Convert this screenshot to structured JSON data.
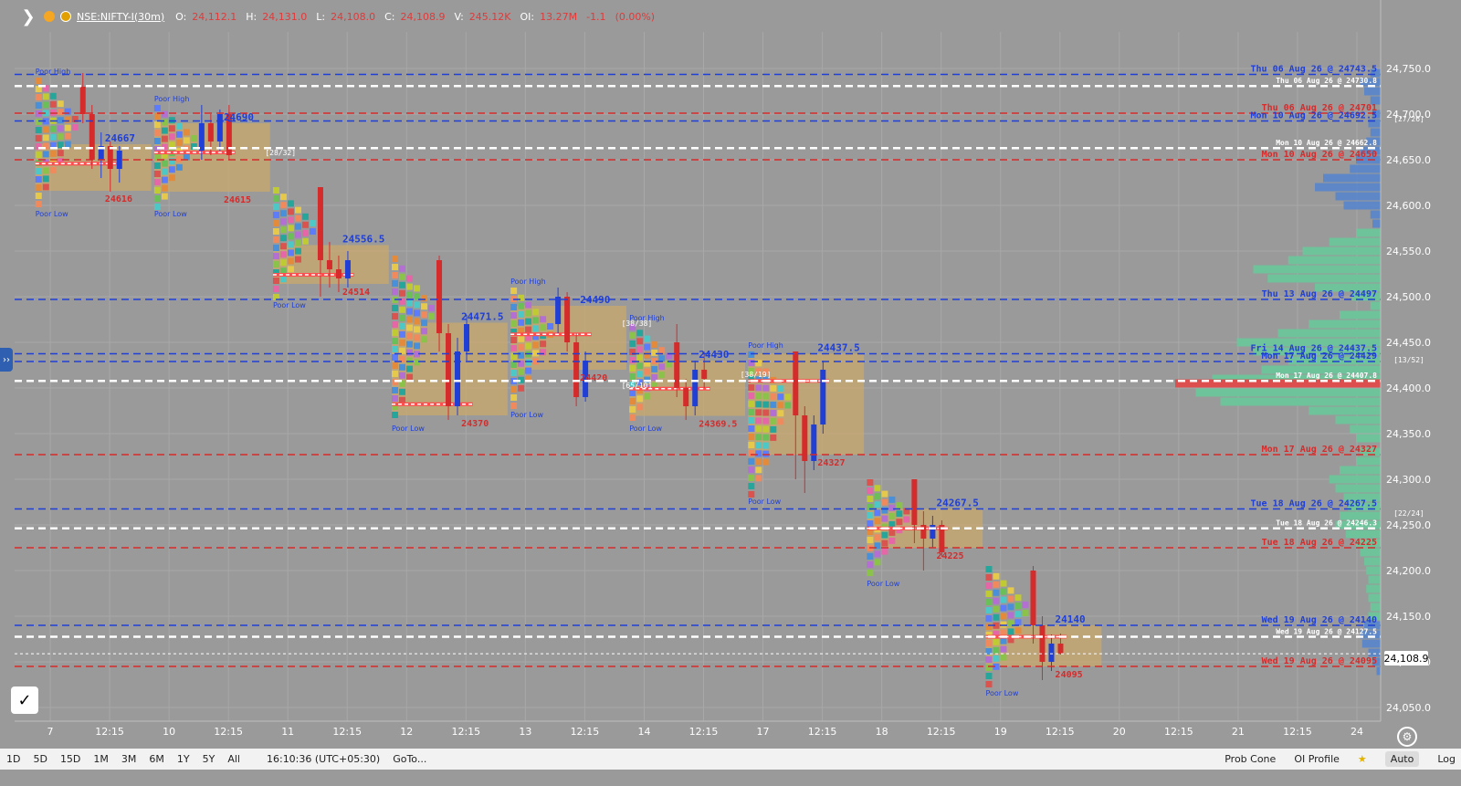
{
  "legend": {
    "symbol": "NSE:NIFTY-I(30m)",
    "o_label": "O:",
    "o_value": "24,112.1",
    "h_label": "H:",
    "h_value": "24,131.0",
    "l_label": "L:",
    "l_value": "24,108.0",
    "c_label": "C:",
    "c_value": "24,108.9",
    "v_label": "V:",
    "v_value": "245.12K",
    "oi_label": "OI:",
    "oi_value": "13.27M",
    "change": "-1.1",
    "change_pct": "(0.00%)"
  },
  "colors": {
    "up": "#1f3fd6",
    "down": "#d62b2b",
    "blue_line": "#1f3fd6",
    "red_line": "#d62b2b",
    "white_line": "#ffffff",
    "vp_green": "#6cc59a",
    "vp_blue": "#5a86c9",
    "vp_red": "#e04a4a",
    "value_area": "#c9a86c"
  },
  "current_price": "24,108.9",
  "bottom": {
    "timeframes": [
      "1D",
      "5D",
      "15D",
      "1M",
      "3M",
      "6M",
      "1Y",
      "5Y",
      "All"
    ],
    "clock": "16:10:36 (UTC+05:30)",
    "goto": "GoTo...",
    "prob_cone": "Prob Cone",
    "oi_profile": "OI Profile",
    "auto": "Auto",
    "log": "Log"
  },
  "chart_data": {
    "type": "market-profile",
    "y_ticks": [
      24750,
      24700,
      24650,
      24600,
      24550,
      24500,
      24450,
      24400,
      24350,
      24300,
      24250,
      24200,
      24150,
      24100,
      24050
    ],
    "y_tick_labels": [
      "24,750.0",
      "24,700.0",
      "24,650.0",
      "24,600.0",
      "24,550.0",
      "24,500.0",
      "24,450.0",
      "24,400.0",
      "24,350.0",
      "24,300.0",
      "24,250.0",
      "24,200.0",
      "24,150.0",
      "24,100.0",
      "24,050.0"
    ],
    "ylim": [
      24035,
      24790
    ],
    "x_ticks": [
      {
        "label": "7",
        "i": 0
      },
      {
        "label": "12:15",
        "i": 1
      },
      {
        "label": "10",
        "i": 2
      },
      {
        "label": "12:15",
        "i": 3
      },
      {
        "label": "11",
        "i": 4
      },
      {
        "label": "12:15",
        "i": 5
      },
      {
        "label": "12",
        "i": 6
      },
      {
        "label": "12:15",
        "i": 7
      },
      {
        "label": "13",
        "i": 8
      },
      {
        "label": "12:15",
        "i": 9
      },
      {
        "label": "14",
        "i": 10
      },
      {
        "label": "12:15",
        "i": 11
      },
      {
        "label": "17",
        "i": 12
      },
      {
        "label": "12:15",
        "i": 13
      },
      {
        "label": "18",
        "i": 14
      },
      {
        "label": "12:15",
        "i": 15
      },
      {
        "label": "19",
        "i": 16
      },
      {
        "label": "12:15",
        "i": 17
      },
      {
        "label": "20",
        "i": 18
      },
      {
        "label": "12:15",
        "i": 19
      },
      {
        "label": "21",
        "i": 20
      },
      {
        "label": "12:15",
        "i": 21
      },
      {
        "label": "24",
        "i": 22
      }
    ],
    "sessions": [
      {
        "day": "7",
        "high": 24740,
        "low": 24600,
        "poc": 24645.8,
        "vah": 24667,
        "val": 24616,
        "candles": [
          [
            24730,
            24700,
            24745,
            24690
          ],
          [
            24700,
            24650,
            24710,
            24640
          ],
          [
            24650,
            24665,
            24680,
            24630
          ],
          [
            24665,
            24640,
            24670,
            24615
          ],
          [
            24640,
            24660,
            24665,
            24625
          ]
        ]
      },
      {
        "day": "10",
        "high": 24710,
        "low": 24600,
        "poc": 24658,
        "vah": 24690,
        "val": 24615,
        "candles": [
          [
            24660,
            24690,
            24710,
            24650
          ],
          [
            24690,
            24670,
            24700,
            24655
          ],
          [
            24670,
            24700,
            24705,
            24660
          ],
          [
            24700,
            24655,
            24710,
            24650
          ]
        ]
      },
      {
        "day": "11",
        "high": 24620,
        "low": 24500,
        "poc": 24524,
        "vah": 24556.5,
        "val": 24514,
        "candles": [
          [
            24620,
            24540,
            24620,
            24500
          ],
          [
            24540,
            24530,
            24560,
            24510
          ],
          [
            24530,
            24520,
            24545,
            24505
          ],
          [
            24520,
            24540,
            24550,
            24510
          ]
        ]
      },
      {
        "day": "12",
        "high": 24545,
        "low": 24365,
        "poc": 24382.3,
        "vah": 24471.5,
        "val": 24370,
        "candles": [
          [
            24540,
            24460,
            24545,
            24440
          ],
          [
            24460,
            24380,
            24470,
            24365
          ],
          [
            24380,
            24440,
            24455,
            24370
          ],
          [
            24440,
            24470,
            24480,
            24430
          ]
        ]
      },
      {
        "day": "13",
        "high": 24510,
        "low": 24380,
        "poc": 24458.8,
        "vah": 24490,
        "val": 24420,
        "candles": [
          [
            24470,
            24500,
            24510,
            24460
          ],
          [
            24500,
            24450,
            24505,
            24440
          ],
          [
            24450,
            24390,
            24460,
            24380
          ],
          [
            24390,
            24430,
            24440,
            24385
          ]
        ]
      },
      {
        "day": "14",
        "high": 24470,
        "low": 24365,
        "poc": 24399.3,
        "vah": 24430,
        "val": 24369.5,
        "candles": [
          [
            24450,
            24400,
            24470,
            24390
          ],
          [
            24400,
            24380,
            24410,
            24365
          ],
          [
            24380,
            24420,
            24430,
            24370
          ],
          [
            24420,
            24410,
            24440,
            24400
          ]
        ]
      },
      {
        "day": "17",
        "high": 24440,
        "low": 24285,
        "poc": 24407.8,
        "vah": 24437.5,
        "val": 24327,
        "candles": [
          [
            24440,
            24370,
            24440,
            24300
          ],
          [
            24370,
            24320,
            24380,
            24285
          ],
          [
            24320,
            24360,
            24370,
            24310
          ],
          [
            24360,
            24420,
            24430,
            24350
          ]
        ]
      },
      {
        "day": "18",
        "high": 24300,
        "low": 24195,
        "poc": 24246.3,
        "vah": 24267.5,
        "val": 24225,
        "candles": [
          [
            24300,
            24250,
            24300,
            24230
          ],
          [
            24250,
            24235,
            24265,
            24200
          ],
          [
            24235,
            24250,
            24260,
            24225
          ],
          [
            24250,
            24220,
            24255,
            24215
          ]
        ]
      },
      {
        "day": "19",
        "high": 24205,
        "low": 24075,
        "poc": 24127.5,
        "vah": 24140,
        "val": 24095,
        "candles": [
          [
            24200,
            24140,
            24205,
            24120
          ],
          [
            24140,
            24100,
            24150,
            24080
          ],
          [
            24100,
            24120,
            24130,
            24090
          ],
          [
            24120,
            24108.9,
            24131,
            24108
          ]
        ]
      }
    ],
    "level_lines": [
      {
        "price": 24743.5,
        "color": "blue",
        "label": "Thu 06 Aug 26 @ 24743.5"
      },
      {
        "price": 24730.8,
        "color": "white",
        "label": "Thu 06 Aug 26 @ 24730.8"
      },
      {
        "price": 24701,
        "color": "red",
        "label": "Thu 06 Aug 26 @ 24701"
      },
      {
        "price": 24692.5,
        "color": "blue",
        "label": "Mon 10 Aug 26 @ 24692.5"
      },
      {
        "price": 24662.8,
        "color": "white",
        "label": "Mon 10 Aug 26 @ 24662.8"
      },
      {
        "price": 24650,
        "color": "red",
        "label": "Mon 10 Aug 26 @ 24650"
      },
      {
        "price": 24497,
        "color": "blue",
        "label": "Thu 13 Aug 26 @ 24497"
      },
      {
        "price": 24437.5,
        "color": "blue",
        "label": "Fri 14 Aug 26 @ 24437.5"
      },
      {
        "price": 24429,
        "color": "blue",
        "label": "Mon 17 Aug 26 @ 24429"
      },
      {
        "price": 24407.8,
        "color": "white",
        "label": "Mon 17 Aug 26 @ 24407.8"
      },
      {
        "price": 24327,
        "color": "red",
        "label": "Mon 17 Aug 26 @ 24327"
      },
      {
        "price": 24267.5,
        "color": "blue",
        "label": "Tue 18 Aug 26 @ 24267.5"
      },
      {
        "price": 24246.3,
        "color": "white",
        "label": "Tue 18 Aug 26 @ 24246.3"
      },
      {
        "price": 24225,
        "color": "red",
        "label": "Tue 18 Aug 26 @ 24225"
      },
      {
        "price": 24140,
        "color": "blue",
        "label": "Wed 19 Aug 26 @ 24140"
      },
      {
        "price": 24127.5,
        "color": "white",
        "label": "Wed 19 Aug 26 @ 24127.5"
      },
      {
        "price": 24095,
        "color": "red",
        "label": "Wed 19 Aug 26 @ 24095"
      }
    ],
    "tpo_counts": [
      "[28/32]",
      "[27/26]",
      "[38/38]",
      "[65/10]",
      "[38/19]",
      "[13/52]",
      "[22/24]"
    ],
    "annotations": [
      {
        "text": "Poor High",
        "day": "7"
      },
      {
        "text": "Poor Low",
        "day": "7"
      },
      {
        "text": "Poor High",
        "day": "10"
      },
      {
        "text": "Poor Low",
        "day": "10"
      },
      {
        "text": "Poor Low",
        "day": "11"
      },
      {
        "text": "Poor Low",
        "day": "12"
      },
      {
        "text": "Poor High",
        "day": "13"
      },
      {
        "text": "Poor Low",
        "day": "13"
      },
      {
        "text": "Poor High",
        "day": "14"
      },
      {
        "text": "Poor Low",
        "day": "14"
      },
      {
        "text": "Poor High",
        "day": "17"
      },
      {
        "text": "Poor Low",
        "day": "17"
      },
      {
        "text": "Poor Low",
        "day": "18"
      },
      {
        "text": "Poor Low",
        "day": "19"
      }
    ],
    "volume_profile": [
      {
        "price": 24745,
        "vol": 0.05,
        "c": "blue"
      },
      {
        "price": 24735,
        "vol": 0.1,
        "c": "blue"
      },
      {
        "price": 24725,
        "vol": 0.08,
        "c": "blue"
      },
      {
        "price": 24715,
        "vol": 0.05,
        "c": "blue"
      },
      {
        "price": 24700,
        "vol": 0.04,
        "c": "blue"
      },
      {
        "price": 24690,
        "vol": 0.06,
        "c": "blue"
      },
      {
        "price": 24680,
        "vol": 0.05,
        "c": "blue"
      },
      {
        "price": 24670,
        "vol": 0.07,
        "c": "blue"
      },
      {
        "price": 24660,
        "vol": 0.1,
        "c": "blue"
      },
      {
        "price": 24650,
        "vol": 0.12,
        "c": "blue"
      },
      {
        "price": 24640,
        "vol": 0.15,
        "c": "blue"
      },
      {
        "price": 24630,
        "vol": 0.28,
        "c": "blue"
      },
      {
        "price": 24620,
        "vol": 0.32,
        "c": "blue"
      },
      {
        "price": 24610,
        "vol": 0.22,
        "c": "blue"
      },
      {
        "price": 24600,
        "vol": 0.18,
        "c": "blue"
      },
      {
        "price": 24590,
        "vol": 0.05,
        "c": "blue"
      },
      {
        "price": 24580,
        "vol": 0.04,
        "c": "blue"
      },
      {
        "price": 24570,
        "vol": 0.12,
        "c": "green"
      },
      {
        "price": 24560,
        "vol": 0.25,
        "c": "green"
      },
      {
        "price": 24550,
        "vol": 0.38,
        "c": "green"
      },
      {
        "price": 24540,
        "vol": 0.45,
        "c": "green"
      },
      {
        "price": 24530,
        "vol": 0.62,
        "c": "green"
      },
      {
        "price": 24520,
        "vol": 0.55,
        "c": "green"
      },
      {
        "price": 24510,
        "vol": 0.32,
        "c": "green"
      },
      {
        "price": 24500,
        "vol": 0.14,
        "c": "green"
      },
      {
        "price": 24490,
        "vol": 0.05,
        "c": "green"
      },
      {
        "price": 24480,
        "vol": 0.2,
        "c": "green"
      },
      {
        "price": 24470,
        "vol": 0.35,
        "c": "green"
      },
      {
        "price": 24460,
        "vol": 0.5,
        "c": "green"
      },
      {
        "price": 24450,
        "vol": 0.7,
        "c": "green"
      },
      {
        "price": 24440,
        "vol": 0.62,
        "c": "green"
      },
      {
        "price": 24430,
        "vol": 0.45,
        "c": "green"
      },
      {
        "price": 24420,
        "vol": 0.58,
        "c": "green"
      },
      {
        "price": 24410,
        "vol": 0.82,
        "c": "green"
      },
      {
        "price": 24405,
        "vol": 1.0,
        "c": "red"
      },
      {
        "price": 24395,
        "vol": 0.9,
        "c": "green"
      },
      {
        "price": 24385,
        "vol": 0.78,
        "c": "green"
      },
      {
        "price": 24375,
        "vol": 0.35,
        "c": "green"
      },
      {
        "price": 24365,
        "vol": 0.22,
        "c": "green"
      },
      {
        "price": 24355,
        "vol": 0.15,
        "c": "green"
      },
      {
        "price": 24345,
        "vol": 0.12,
        "c": "green"
      },
      {
        "price": 24330,
        "vol": 0.1,
        "c": "green"
      },
      {
        "price": 24320,
        "vol": 0.12,
        "c": "green"
      },
      {
        "price": 24310,
        "vol": 0.2,
        "c": "green"
      },
      {
        "price": 24300,
        "vol": 0.25,
        "c": "green"
      },
      {
        "price": 24290,
        "vol": 0.22,
        "c": "green"
      },
      {
        "price": 24280,
        "vol": 0.18,
        "c": "green"
      },
      {
        "price": 24270,
        "vol": 0.16,
        "c": "green"
      },
      {
        "price": 24260,
        "vol": 0.2,
        "c": "green"
      },
      {
        "price": 24250,
        "vol": 0.22,
        "c": "green"
      },
      {
        "price": 24240,
        "vol": 0.17,
        "c": "green"
      },
      {
        "price": 24230,
        "vol": 0.12,
        "c": "green"
      },
      {
        "price": 24220,
        "vol": 0.1,
        "c": "green"
      },
      {
        "price": 24210,
        "vol": 0.08,
        "c": "green"
      },
      {
        "price": 24200,
        "vol": 0.07,
        "c": "green"
      },
      {
        "price": 24190,
        "vol": 0.06,
        "c": "green"
      },
      {
        "price": 24180,
        "vol": 0.07,
        "c": "green"
      },
      {
        "price": 24170,
        "vol": 0.06,
        "c": "green"
      },
      {
        "price": 24160,
        "vol": 0.05,
        "c": "green"
      },
      {
        "price": 24150,
        "vol": 0.06,
        "c": "green"
      },
      {
        "price": 24140,
        "vol": 0.08,
        "c": "blue"
      },
      {
        "price": 24130,
        "vol": 0.1,
        "c": "blue"
      },
      {
        "price": 24120,
        "vol": 0.09,
        "c": "blue"
      },
      {
        "price": 24110,
        "vol": 0.06,
        "c": "blue"
      },
      {
        "price": 24100,
        "vol": 0.04,
        "c": "blue"
      },
      {
        "price": 24090,
        "vol": 0.02,
        "c": "blue"
      }
    ]
  }
}
